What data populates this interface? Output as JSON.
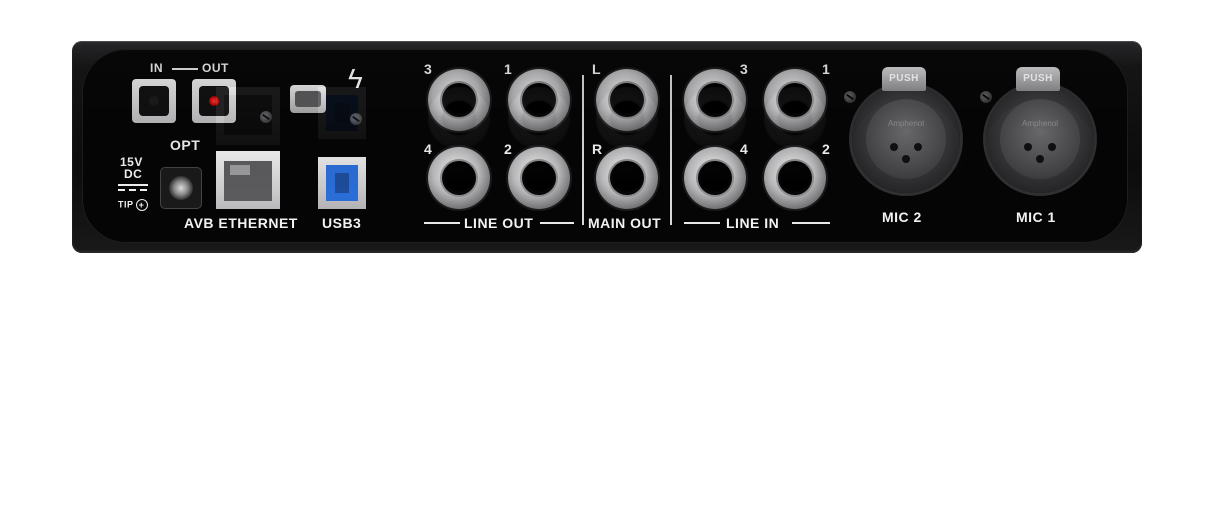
{
  "optical": {
    "in_label": "IN",
    "out_label": "OUT",
    "label": "OPT"
  },
  "power": {
    "voltage": "15V",
    "type": "DC",
    "tip": "TIP"
  },
  "ethernet": {
    "label": "AVB ETHERNET"
  },
  "usb": {
    "label": "USB3"
  },
  "line_out": {
    "label": "LINE OUT",
    "jacks": [
      "3",
      "1",
      "4",
      "2"
    ]
  },
  "main_out": {
    "label": "MAIN OUT",
    "jacks": [
      "L",
      "R"
    ]
  },
  "line_in": {
    "label": "LINE IN",
    "jacks": [
      "3",
      "1",
      "4",
      "2"
    ]
  },
  "mics": [
    {
      "label": "MIC 2",
      "push": "PUSH",
      "brand": "Amphenol"
    },
    {
      "label": "MIC 1",
      "push": "PUSH",
      "brand": "Amphenol"
    }
  ],
  "icons": [
    "thunderbolt-icon",
    "positive-tip-icon",
    "dc-symbol-icon"
  ],
  "colors": {
    "chassis": "#0b0b0c",
    "label_text": "#f2f2f2",
    "usb3_blue": "#2b6dd6",
    "optical_led": "#d80000"
  }
}
